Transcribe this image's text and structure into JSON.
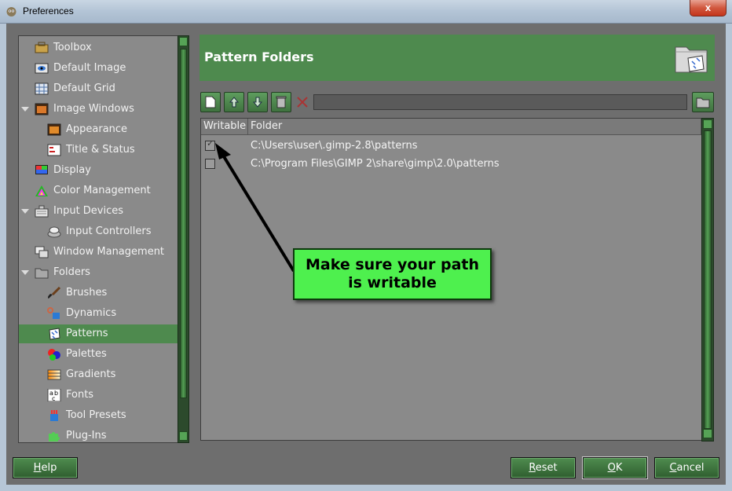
{
  "window": {
    "title": "Preferences",
    "close_label": "x"
  },
  "sidebar": {
    "items": [
      {
        "label": "Toolbox",
        "icon": "toolbox-icon"
      },
      {
        "label": "Default Image",
        "icon": "default-image-icon"
      },
      {
        "label": "Default Grid",
        "icon": "grid-icon"
      },
      {
        "label": "Image Windows",
        "icon": "image-windows-icon"
      },
      {
        "label": "Appearance",
        "icon": "appearance-icon"
      },
      {
        "label": "Title & Status",
        "icon": "title-status-icon"
      },
      {
        "label": "Display",
        "icon": "display-icon"
      },
      {
        "label": "Color Management",
        "icon": "color-management-icon"
      },
      {
        "label": "Input Devices",
        "icon": "input-devices-icon"
      },
      {
        "label": "Input Controllers",
        "icon": "input-controllers-icon"
      },
      {
        "label": "Window Management",
        "icon": "window-management-icon"
      },
      {
        "label": "Folders",
        "icon": "folders-icon"
      },
      {
        "label": "Brushes",
        "icon": "brushes-icon"
      },
      {
        "label": "Dynamics",
        "icon": "dynamics-icon"
      },
      {
        "label": "Patterns",
        "icon": "patterns-icon",
        "selected": true
      },
      {
        "label": "Palettes",
        "icon": "palettes-icon"
      },
      {
        "label": "Gradients",
        "icon": "gradients-icon"
      },
      {
        "label": "Fonts",
        "icon": "fonts-icon"
      },
      {
        "label": "Tool Presets",
        "icon": "tool-presets-icon"
      },
      {
        "label": "Plug-Ins",
        "icon": "plug-ins-icon"
      }
    ]
  },
  "header": {
    "title": "Pattern Folders",
    "icon": "pattern-folder-icon"
  },
  "toolbar": {
    "buttons": [
      "new-folder-icon",
      "move-up-icon",
      "move-down-icon",
      "delete-folder-icon"
    ],
    "path_value": ""
  },
  "list": {
    "columns": [
      "Writable",
      "Folder"
    ],
    "rows": [
      {
        "writable": true,
        "folder": "C:\\Users\\user\\.gimp-2.8\\patterns"
      },
      {
        "writable": false,
        "folder": "C:\\Program Files\\GIMP 2\\share\\gimp\\2.0\\patterns"
      }
    ]
  },
  "annotation": {
    "line1": "Make sure your path",
    "line2": "is writable"
  },
  "buttons": {
    "help": {
      "mnemonic": "H",
      "rest": "elp"
    },
    "reset": {
      "mnemonic": "R",
      "rest": "eset"
    },
    "ok": {
      "mnemonic": "O",
      "rest": "K"
    },
    "cancel": {
      "mnemonic": "C",
      "rest": "ancel"
    }
  },
  "colors": {
    "accent": "#4e8a4e",
    "panel": "#8a8a8a",
    "callout": "#4ef04e"
  }
}
